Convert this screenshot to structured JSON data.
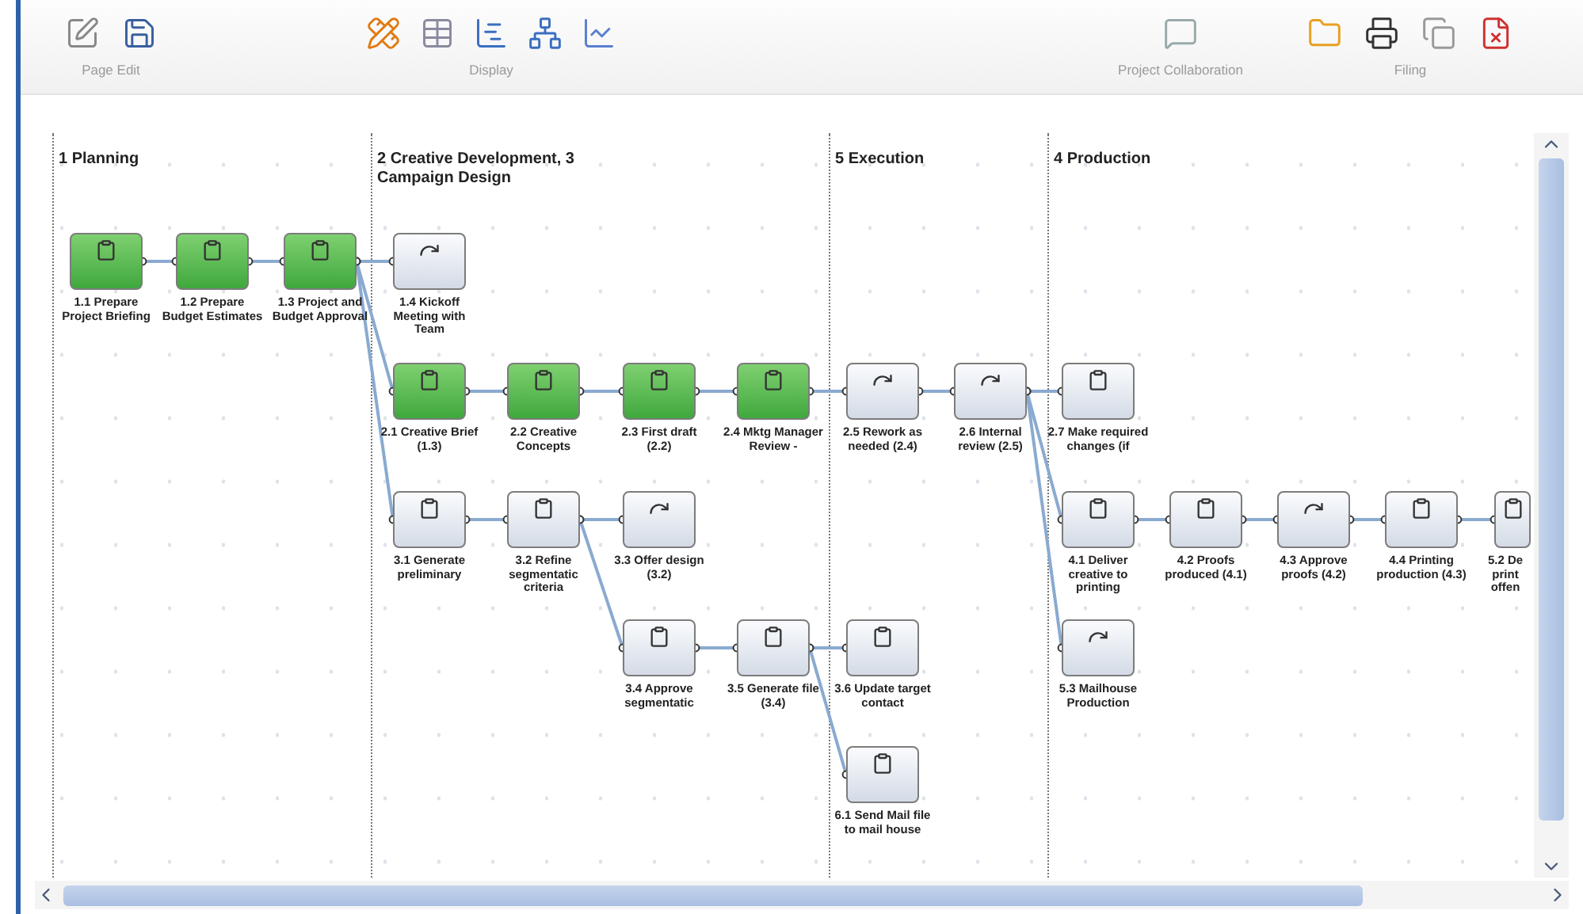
{
  "toolbar": {
    "groups": [
      {
        "label": "Page Edit"
      },
      {
        "label": "Display"
      },
      {
        "label": "Project Collaboration"
      },
      {
        "label": "Filing"
      }
    ]
  },
  "lanes": [
    {
      "title": "1 Planning"
    },
    {
      "title": "2 Creative Development, 3 Campaign Design"
    },
    {
      "title": "5 Execution"
    },
    {
      "title": "4 Production"
    }
  ],
  "nodes": [
    {
      "label": "1.1 Prepare Project Briefing",
      "completed": true,
      "kind": "task"
    },
    {
      "label": "1.2 Prepare Budget Estimates",
      "completed": true,
      "kind": "task"
    },
    {
      "label": "1.3 Project and Budget Approval",
      "completed": true,
      "kind": "task"
    },
    {
      "label": "1.4 Kickoff Meeting with Team",
      "completed": false,
      "kind": "rework"
    },
    {
      "label": "2.1 Creative Brief (1.3)",
      "completed": true,
      "kind": "task"
    },
    {
      "label": "2.2 Creative Concepts",
      "completed": true,
      "kind": "task"
    },
    {
      "label": "2.3 First draft (2.2)",
      "completed": true,
      "kind": "task"
    },
    {
      "label": "2.4 Mktg Manager Review -",
      "completed": true,
      "kind": "task"
    },
    {
      "label": "2.5 Rework as needed (2.4)",
      "completed": false,
      "kind": "rework"
    },
    {
      "label": "2.6 Internal review (2.5)",
      "completed": false,
      "kind": "rework"
    },
    {
      "label": "2.7 Make required changes (if",
      "completed": false,
      "kind": "task"
    },
    {
      "label": "3.1 Generate preliminary",
      "completed": false,
      "kind": "task"
    },
    {
      "label": "3.2 Refine segmentatic criteria",
      "completed": false,
      "kind": "task"
    },
    {
      "label": "3.3 Offer design (3.2)",
      "completed": false,
      "kind": "rework"
    },
    {
      "label": "4.1 Deliver creative to printing",
      "completed": false,
      "kind": "task"
    },
    {
      "label": "4.2 Proofs produced (4.1)",
      "completed": false,
      "kind": "task"
    },
    {
      "label": "4.3 Approve proofs (4.2)",
      "completed": false,
      "kind": "rework"
    },
    {
      "label": "4.4 Printing production (4.3)",
      "completed": false,
      "kind": "task"
    },
    {
      "label": "5.2 De print offen",
      "completed": false,
      "kind": "task"
    },
    {
      "label": "3.4 Approve segmentatic",
      "completed": false,
      "kind": "task"
    },
    {
      "label": "3.5 Generate file (3.4)",
      "completed": false,
      "kind": "task"
    },
    {
      "label": "3.6 Update target contact",
      "completed": false,
      "kind": "task"
    },
    {
      "label": "5.3 Mailhouse Production",
      "completed": false,
      "kind": "rework"
    },
    {
      "label": "6.1 Send Mail file to mail house",
      "completed": false,
      "kind": "task"
    }
  ]
}
